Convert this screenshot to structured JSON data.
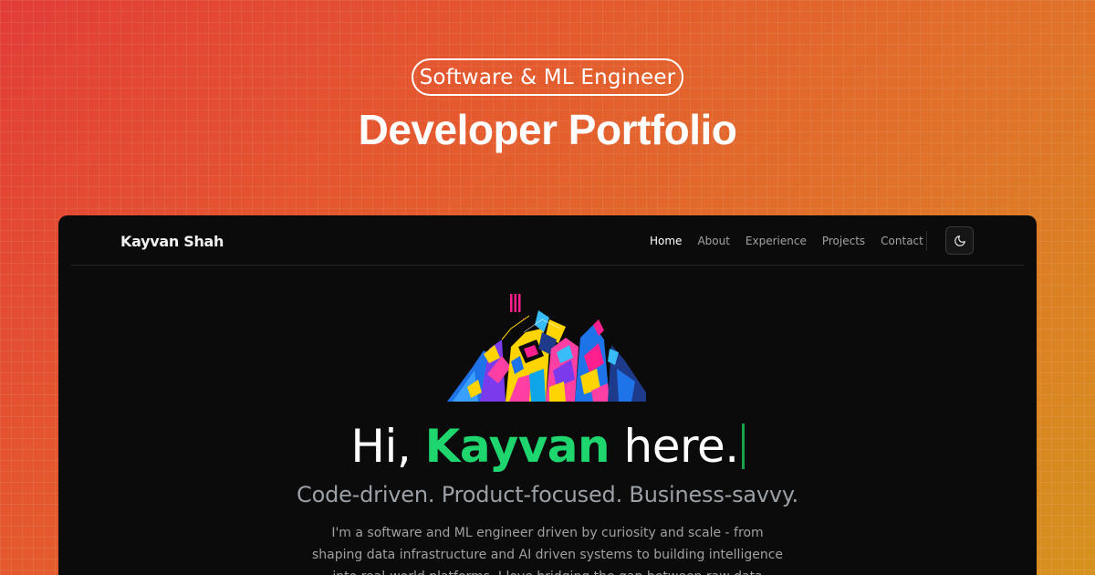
{
  "banner": {
    "pill_label": "Software & ML Engineer",
    "headline": "Developer Portfolio"
  },
  "navbar": {
    "brand": "Kayvan Shah",
    "links": [
      "Home",
      "About",
      "Experience",
      "Projects",
      "Contact"
    ],
    "active_link": "Home",
    "theme_toggle_icon": "moon-icon"
  },
  "hero": {
    "greeting_prefix": "Hi, ",
    "name": "Kayvan",
    "greeting_suffix": " here.",
    "tagline": "Code-driven. Product-focused. Business-savvy.",
    "bio": "I'm a software and ML engineer driven by curiosity and scale - from shaping data infrastructure and AI driven systems to building intelligence into real-world platforms. I love bridging the gap between raw data"
  },
  "colors": {
    "accent_green": "#1fd66e",
    "window_bg": "#0b0b0b",
    "gradient_start": "#e23d37",
    "gradient_end": "#d6921e"
  }
}
